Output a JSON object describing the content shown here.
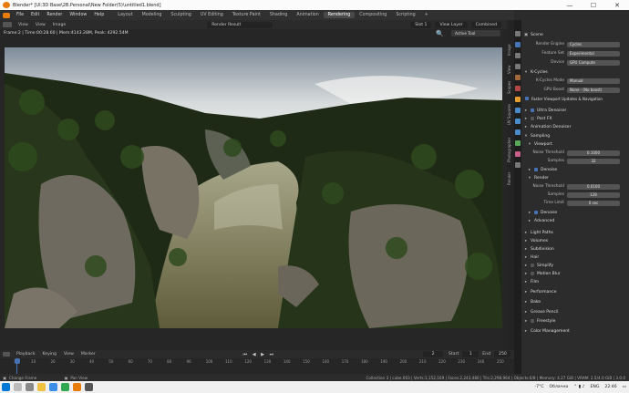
{
  "window": {
    "title": "Blender* [UI:3D Base\\2B.Personal\\New Folder(5)\\untitled1.blend]",
    "minimize": "—",
    "maximize": "☐",
    "close": "✕"
  },
  "menubar": {
    "items": [
      "File",
      "Edit",
      "Render",
      "Window",
      "Help"
    ],
    "workspaces": [
      "Layout",
      "Modeling",
      "Sculpting",
      "UV Editing",
      "Texture Paint",
      "Shading",
      "Animation",
      "Rendering",
      "Compositing",
      "Scripting"
    ],
    "active_workspace": "Rendering",
    "plus": "+"
  },
  "header_right": {
    "scene_label": "Scene",
    "view_layer": "View Layer"
  },
  "viewport": {
    "menus": [
      "View",
      "View",
      "Image"
    ],
    "render_slot": "Render Result",
    "slot": "Slot 1",
    "view_layer": "View Layer",
    "pass": "Combined",
    "active_tool": "Active Tool",
    "frame_info": "Frame:2 | Time:00:28.60 | Mem:4143.28M, Peak: 4292.54M"
  },
  "side_tabs": [
    "Image",
    "View",
    "Scopes",
    "UV Squares",
    "Photographer",
    "Render"
  ],
  "properties": {
    "scene_crumb": "Scene",
    "render_engine_label": "Render Engine",
    "render_engine": "Cycles",
    "feature_set_label": "Feature Set",
    "feature_set": "Experimental",
    "device_label": "Device",
    "device": "GPU Compute",
    "kcycles": "K-Cycles",
    "kcycles_mode_label": "K-Cycles Mode",
    "kcycles_mode": "Manual",
    "gpu_boost_label": "GPU Boost",
    "gpu_boost": "None - (No boost)",
    "faster_viewport": "Faster Viewport Updates & Navigation",
    "ultra_denoiser": "Ultra Denoiser",
    "post_fx": "Post FX",
    "anim_denoiser": "Animation Denoiser",
    "sampling": "Sampling",
    "viewport": "Viewport",
    "noise_threshold_label": "Noise Threshold",
    "noise_threshold_vp": "0.1000",
    "samples_label": "Samples",
    "samples_vp": "32",
    "denoise": "Denoise",
    "render": "Render",
    "noise_threshold_r": "0.0100",
    "samples_r": "128",
    "time_limit_label": "Time Limit",
    "time_limit": "0 sec",
    "denoise_r": "Denoise",
    "advanced": "Advanced",
    "sections": [
      "Light Paths",
      "Volumes",
      "Subdivision",
      "Hair",
      "Simplify",
      "Motion Blur",
      "Film",
      "Performance",
      "Bake",
      "Grease Pencil",
      "Freestyle",
      "Color Management"
    ]
  },
  "timeline": {
    "menus": [
      "Playback",
      "Keying",
      "View",
      "Marker"
    ],
    "current_frame": "2",
    "start_label": "Start",
    "start": "1",
    "end_label": "End",
    "end": "250",
    "ticks": [
      "1",
      "10",
      "20",
      "30",
      "40",
      "50",
      "60",
      "70",
      "80",
      "90",
      "100",
      "110",
      "120",
      "130",
      "140",
      "150",
      "160",
      "170",
      "180",
      "190",
      "200",
      "210",
      "220",
      "230",
      "240",
      "250"
    ]
  },
  "statusbar": {
    "left1": "Change Frame",
    "left2": "Pan View",
    "right": "Collection 3 | cube.003 | Verts:1,152,169 | Faces:2,243,480 | Tris:2,298,964 | Objects:0/8 | Memory: 4.27 GiB | VRAM: 2.5/4.0 GiB | 3.0.0"
  },
  "taskbar": {
    "temp": "-7°C",
    "weather": "Облачно",
    "lang": "ENG",
    "time": "22:46"
  },
  "colors": {
    "accent": "#4772b3",
    "panel": "#2c2c2c",
    "bg": "#1d1d1d"
  }
}
